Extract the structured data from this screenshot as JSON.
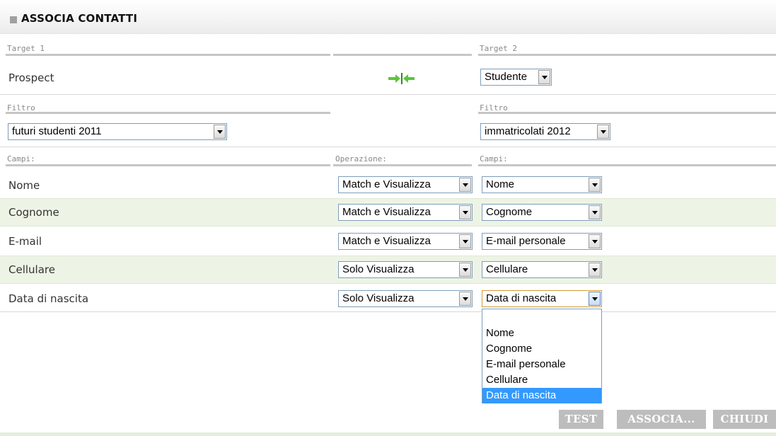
{
  "header": {
    "title": "ASSOCIA CONTATTI"
  },
  "target1": {
    "label": "Target 1",
    "value": "Prospect"
  },
  "target2": {
    "label": "Target 2",
    "selected": "Studente"
  },
  "filter1": {
    "label": "Filtro",
    "selected": "futuri studenti 2011"
  },
  "filter2": {
    "label": "Filtro",
    "selected": "immatricolati 2012"
  },
  "columns": {
    "fields_left": "Campi:",
    "operation": "Operazione:",
    "fields_right": "Campi:"
  },
  "rows": [
    {
      "field": "Nome",
      "operation": "Match e Visualizza",
      "target_field": "Nome"
    },
    {
      "field": "Cognome",
      "operation": "Match e Visualizza",
      "target_field": "Cognome"
    },
    {
      "field": "E-mail",
      "operation": "Match e Visualizza",
      "target_field": "E-mail personale"
    },
    {
      "field": "Cellulare",
      "operation": "Solo Visualizza",
      "target_field": "Cellulare"
    },
    {
      "field": "Data di nascita",
      "operation": "Solo Visualizza",
      "target_field": "Data di nascita"
    }
  ],
  "open_dropdown": {
    "options": [
      "",
      "Nome",
      "Cognome",
      "E-mail personale",
      "Cellulare",
      "Data di nascita"
    ],
    "highlighted": "Data di nascita"
  },
  "buttons": {
    "test": "TEST",
    "associa": "ASSOCIA...",
    "chiudi": "CHIUDI"
  },
  "icons": {
    "merge": "merge-arrows-icon",
    "title_bullet": "square-bullet-icon"
  },
  "colors": {
    "stripe": "#edf4e5",
    "button": "#bdbdbd",
    "highlight": "#3399ff",
    "arrow_green": "#5cc43c"
  }
}
